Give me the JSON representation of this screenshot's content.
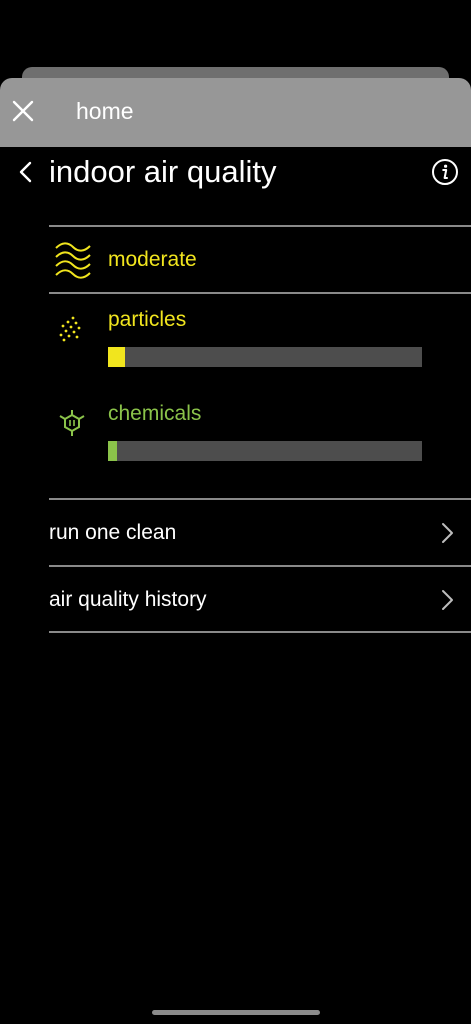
{
  "top_bar": {
    "title": "home",
    "close_icon": "close-icon"
  },
  "header": {
    "title": "indoor air quality",
    "back_icon": "chevron-left-icon",
    "info_icon": "info-icon"
  },
  "status": {
    "label": "moderate",
    "icon": "waves-icon",
    "color": "#f1e51e"
  },
  "metrics": [
    {
      "label": "particles",
      "icon": "particles-icon",
      "color": "#f1e51e",
      "level_fraction": 0.055
    },
    {
      "label": "chemicals",
      "icon": "molecule-icon",
      "color": "#8bc34a",
      "level_fraction": 0.03
    }
  ],
  "nav": [
    {
      "label": "run one clean",
      "icon": "chevron-right-icon"
    },
    {
      "label": "air quality history",
      "icon": "chevron-right-icon"
    }
  ]
}
